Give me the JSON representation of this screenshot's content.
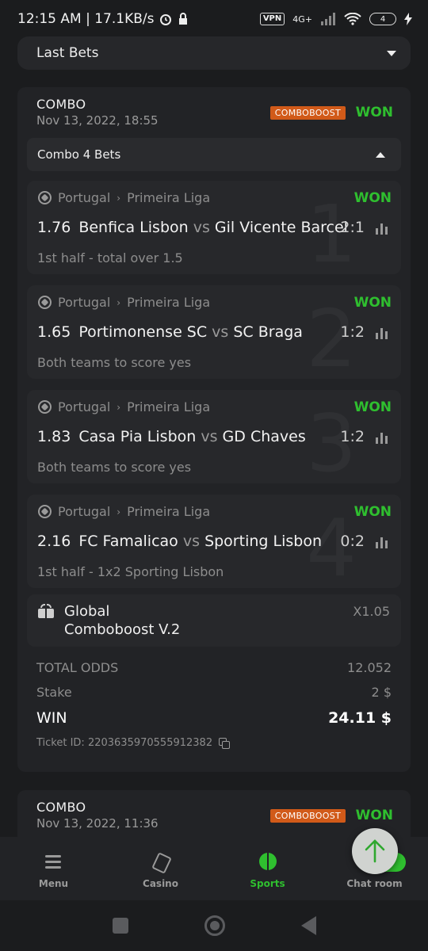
{
  "status_bar": {
    "time_speed": "12:15 AM | 17.1KB/s",
    "vpn": "VPN",
    "network": "4G+",
    "battery": "4"
  },
  "header": {
    "last_bets_label": "Last Bets"
  },
  "combo1": {
    "title": "COMBO",
    "date": "Nov 13, 2022, 18:55",
    "badge": "COMBOBOOST",
    "status": "WON",
    "sub_header": "Combo 4 Bets",
    "legs": [
      {
        "number": "1",
        "league_country": "Portugal",
        "league_name": "Primeira Liga",
        "status": "WON",
        "odd": "1.76",
        "home": "Benfica Lisbon",
        "vs": "vs",
        "away": "Gil Vicente Barcelos",
        "score": "2:1",
        "market": "1st half - total over 1.5"
      },
      {
        "number": "2",
        "league_country": "Portugal",
        "league_name": "Primeira Liga",
        "status": "WON",
        "odd": "1.65",
        "home": "Portimonense SC",
        "vs": "vs",
        "away": "SC Braga",
        "score": "1:2",
        "market": "Both teams to score yes"
      },
      {
        "number": "3",
        "league_country": "Portugal",
        "league_name": "Primeira Liga",
        "status": "WON",
        "odd": "1.83",
        "home": "Casa Pia Lisbon",
        "vs": "vs",
        "away": "GD Chaves",
        "score": "1:2",
        "market": "Both teams to score yes"
      },
      {
        "number": "4",
        "league_country": "Portugal",
        "league_name": "Primeira Liga",
        "status": "WON",
        "odd": "2.16",
        "home": "FC Famalicao",
        "vs": "vs",
        "away": "Sporting Lisbon",
        "score": "0:2",
        "market": "1st half - 1x2 Sporting Lisbon"
      }
    ],
    "boost": {
      "name_line1": "Global",
      "name_line2": "Comboboost V.2",
      "multiplier": "X1.05"
    },
    "total_odds_label": "TOTAL ODDS",
    "total_odds_value": "12.052",
    "stake_label": "Stake",
    "stake_value": "2 $",
    "win_label": "WIN",
    "win_value": "24.11 $",
    "ticket_id": "Ticket ID: 2203635970555912382"
  },
  "combo2": {
    "title": "COMBO",
    "date": "Nov 13, 2022, 11:36",
    "badge": "COMBOBOOST",
    "status": "WON"
  },
  "nav": {
    "menu": "Menu",
    "casino": "Casino",
    "sports": "Sports",
    "chat": "Chat room"
  },
  "colors": {
    "accent_green": "#2fbf2f",
    "boost_orange": "#d15a19",
    "background": "#1b1c1e"
  }
}
